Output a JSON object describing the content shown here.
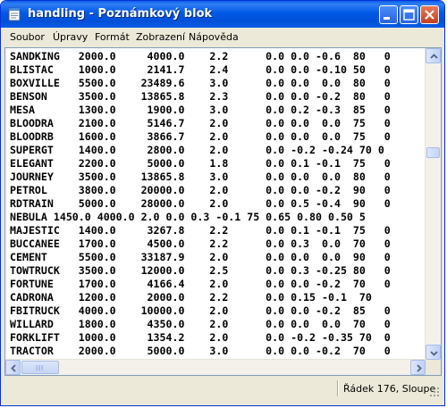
{
  "window": {
    "title": "handling - Poznámkový blok"
  },
  "menu": [
    "Soubor",
    "Úpravy",
    "Formát",
    "Zobrazení",
    "Nápověda"
  ],
  "lines": [
    "SANDKING   2000.0     4000.0    2.2      0.0 0.0 -0.6  80   0",
    "BLISTAC    1000.0     2141.7    2.4      0.0 0.0 -0.10 50   0",
    "BOXVILLE   5500.0    23489.6    3.0      0.0 0.0  0.0  80   0",
    "BENSON     3500.0    13865.8    2.3      0.0 0.0 -0.2  80   0",
    "MESA       1300.0     1900.0    3.0      0.0 0.2 -0.3  85   0",
    "BLOODRA    2100.0     5146.7    2.0      0.0 0.0  0.0  75   0",
    "BLOODRB    1600.0     3866.7    2.0      0.0 0.0  0.0  75   0",
    "SUPERGT    1400.0     2800.0    2.0      0.0 -0.2 -0.24 70 0",
    "ELEGANT    2200.0     5000.0    1.8      0.0 0.1 -0.1  75   0",
    "JOURNEY    3500.0    13865.8    3.0      0.0 0.0  0.0  80   0",
    "PETROL     3800.0    20000.0    2.0      0.0 0.0 -0.2  90   0",
    "RDTRAIN    5000.0    28000.0    2.0      0.0 0.5 -0.4  90   0",
    "NEBULA 1450.0 4000.0 2.0 0.0 0.3 -0.1 75 0.65 0.80 0.50 5",
    "MAJESTIC   1400.0     3267.8    2.2      0.0 0.1 -0.1  75   0",
    "BUCCANEE   1700.0     4500.0    2.2      0.0 0.3  0.0  70   0",
    "CEMENT     5500.0    33187.9    2.0      0.0 0.0  0.0  90   0",
    "TOWTRUCK   3500.0    12000.0    2.5      0.0 0.3 -0.25 80   0",
    "FORTUNE    1700.0     4166.4    2.0      0.0 0.0 -0.2  70   0",
    "CADRONA    1200.0     2000.0    2.2      0.0 0.15 -0.1  70",
    "FBITRUCK   4000.0    10000.0    2.0      0.0 0.0 -0.2  85   0",
    "WILLARD    1800.0     4350.0    2.0      0.0 0.0  0.0  70   0",
    "FORKLIFT   1000.0     1354.2    2.0      0.0 -0.2 -0.35 70  0",
    "TRACTOR    2000.0     5000.0    3.0      0.0 0.0 -0.2  70   0"
  ],
  "status": {
    "position": "Řádek 176, Sloupe"
  },
  "icons": {
    "app": "notepad-icon",
    "minimize": "minimize-icon",
    "maximize": "maximize-icon",
    "close": "close-icon"
  },
  "colors": {
    "titlebar": "#0058e6",
    "window_frame": "#ece9d8",
    "close_button": "#c4411c"
  }
}
